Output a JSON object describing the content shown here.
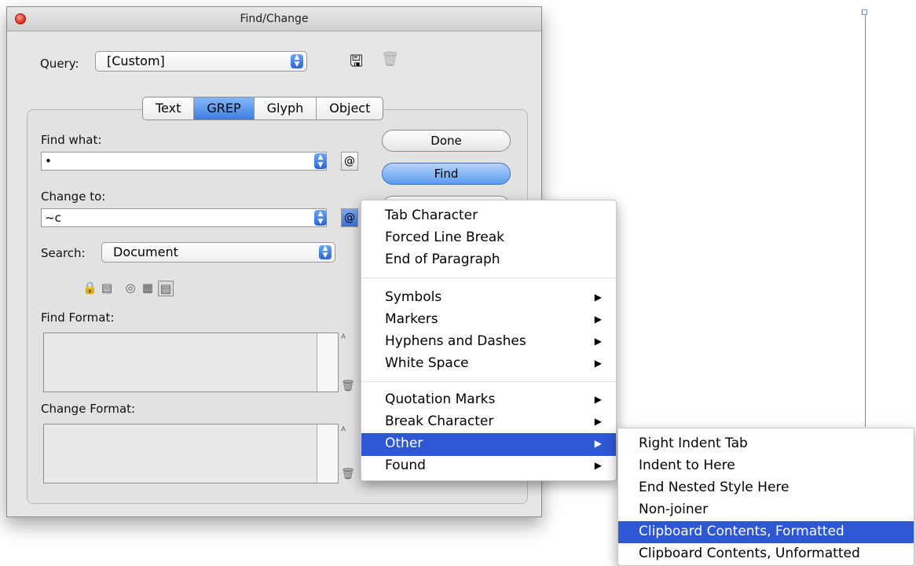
{
  "dialog": {
    "title": "Find/Change",
    "query_label": "Query:",
    "query_value": "[Custom]",
    "tabs": [
      {
        "label": "Text"
      },
      {
        "label": "GREP"
      },
      {
        "label": "Glyph"
      },
      {
        "label": "Object"
      }
    ],
    "active_tab": "GREP",
    "find_what_label": "Find what:",
    "find_what_value": "•",
    "change_to_label": "Change to:",
    "change_to_value": "~c",
    "search_label": "Search:",
    "search_value": "Document",
    "find_format_label": "Find Format:",
    "change_format_label": "Change Format:",
    "buttons": {
      "done": "Done",
      "find": "Find"
    }
  },
  "menu": {
    "items": [
      {
        "label": "Tab Character",
        "has_submenu": false
      },
      {
        "label": "Forced Line Break",
        "has_submenu": false
      },
      {
        "label": "End of Paragraph",
        "has_submenu": false
      },
      {
        "label": "Symbols",
        "has_submenu": true
      },
      {
        "label": "Markers",
        "has_submenu": true
      },
      {
        "label": "Hyphens and Dashes",
        "has_submenu": true
      },
      {
        "label": "White Space",
        "has_submenu": true
      },
      {
        "label": "Quotation Marks",
        "has_submenu": true
      },
      {
        "label": "Break Character",
        "has_submenu": true
      },
      {
        "label": "Other",
        "has_submenu": true,
        "highlighted": true
      },
      {
        "label": "Found",
        "has_submenu": true
      }
    ]
  },
  "submenu": {
    "items": [
      {
        "label": "Right Indent Tab"
      },
      {
        "label": "Indent to Here"
      },
      {
        "label": "End Nested Style Here"
      },
      {
        "label": "Non-joiner"
      },
      {
        "label": "Clipboard Contents, Formatted",
        "highlighted": true
      },
      {
        "label": "Clipboard Contents, Unformatted"
      }
    ]
  },
  "colors": {
    "selection": "#2e57d6",
    "accent": "#3c7de0"
  }
}
